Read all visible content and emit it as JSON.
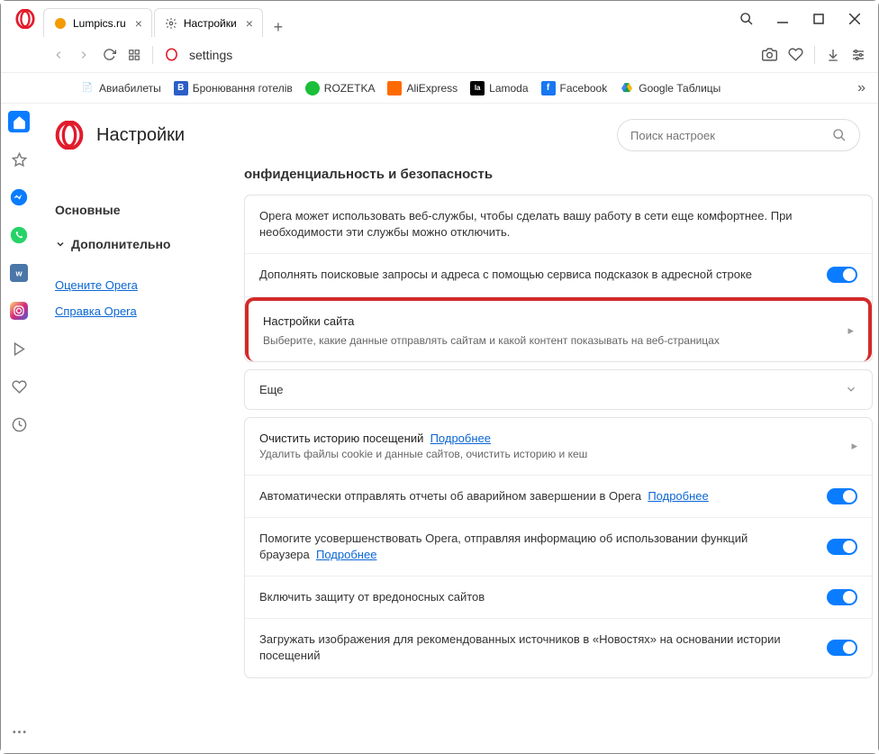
{
  "tabs": [
    {
      "title": "Lumpics.ru",
      "favicon_color": "#f59b00"
    },
    {
      "title": "Настройки",
      "active": true
    }
  ],
  "address": {
    "text": "settings"
  },
  "bookmarks": [
    {
      "label": "Авиабилеты",
      "icon_bg": "#333",
      "icon_char": ""
    },
    {
      "label": "Бронювання готелів",
      "icon_bg": "#2b5fc7",
      "icon_char": "B"
    },
    {
      "label": "ROZETKA",
      "icon_bg": "#1bbf3a",
      "icon_char": ""
    },
    {
      "label": "AliExpress",
      "icon_bg": "#ff6a00",
      "icon_char": ""
    },
    {
      "label": "Lamoda",
      "icon_bg": "#000",
      "icon_char": "la"
    },
    {
      "label": "Facebook",
      "icon_bg": "#1877f2",
      "icon_char": "f"
    },
    {
      "label": "Google Таблицы",
      "icon_bg": "#fff",
      "icon_char": ""
    }
  ],
  "settings": {
    "page_title": "Настройки",
    "search_placeholder": "Поиск настроек",
    "nav": {
      "main": "Основные",
      "advanced": "Дополнительно",
      "rate": "Оцените Opera",
      "help": "Справка Opera"
    },
    "section": {
      "title": "онфиденциальность и безопасность",
      "intro": "Opera может использовать веб-службы, чтобы сделать вашу работу в сети еще комфортнее. При необходимости эти службы можно отключить.",
      "row_autofill": "Дополнять поисковые запросы и адреса с помощью сервиса подсказок в адресной строке",
      "site_settings_title": "Настройки сайта",
      "site_settings_sub": "Выберите, какие данные отправлять сайтам и какой контент показывать на веб-страницах",
      "more": "Еще",
      "clear_history_title": "Очистить историю посещений",
      "clear_history_link": "Подробнее",
      "clear_history_sub": "Удалить файлы cookie и данные сайтов, очистить историю и кеш",
      "crash_reports": "Автоматически отправлять отчеты об аварийном завершении в Opera",
      "improve": "Помогите усовершенствовать Opera, отправляя информацию об использовании функций браузера",
      "malware": "Включить защиту от вредоносных сайтов",
      "news_images": "Загружать изображения для рекомендованных источников в «Новостях» на основании истории посещений",
      "more_link": "Подробнее"
    }
  }
}
